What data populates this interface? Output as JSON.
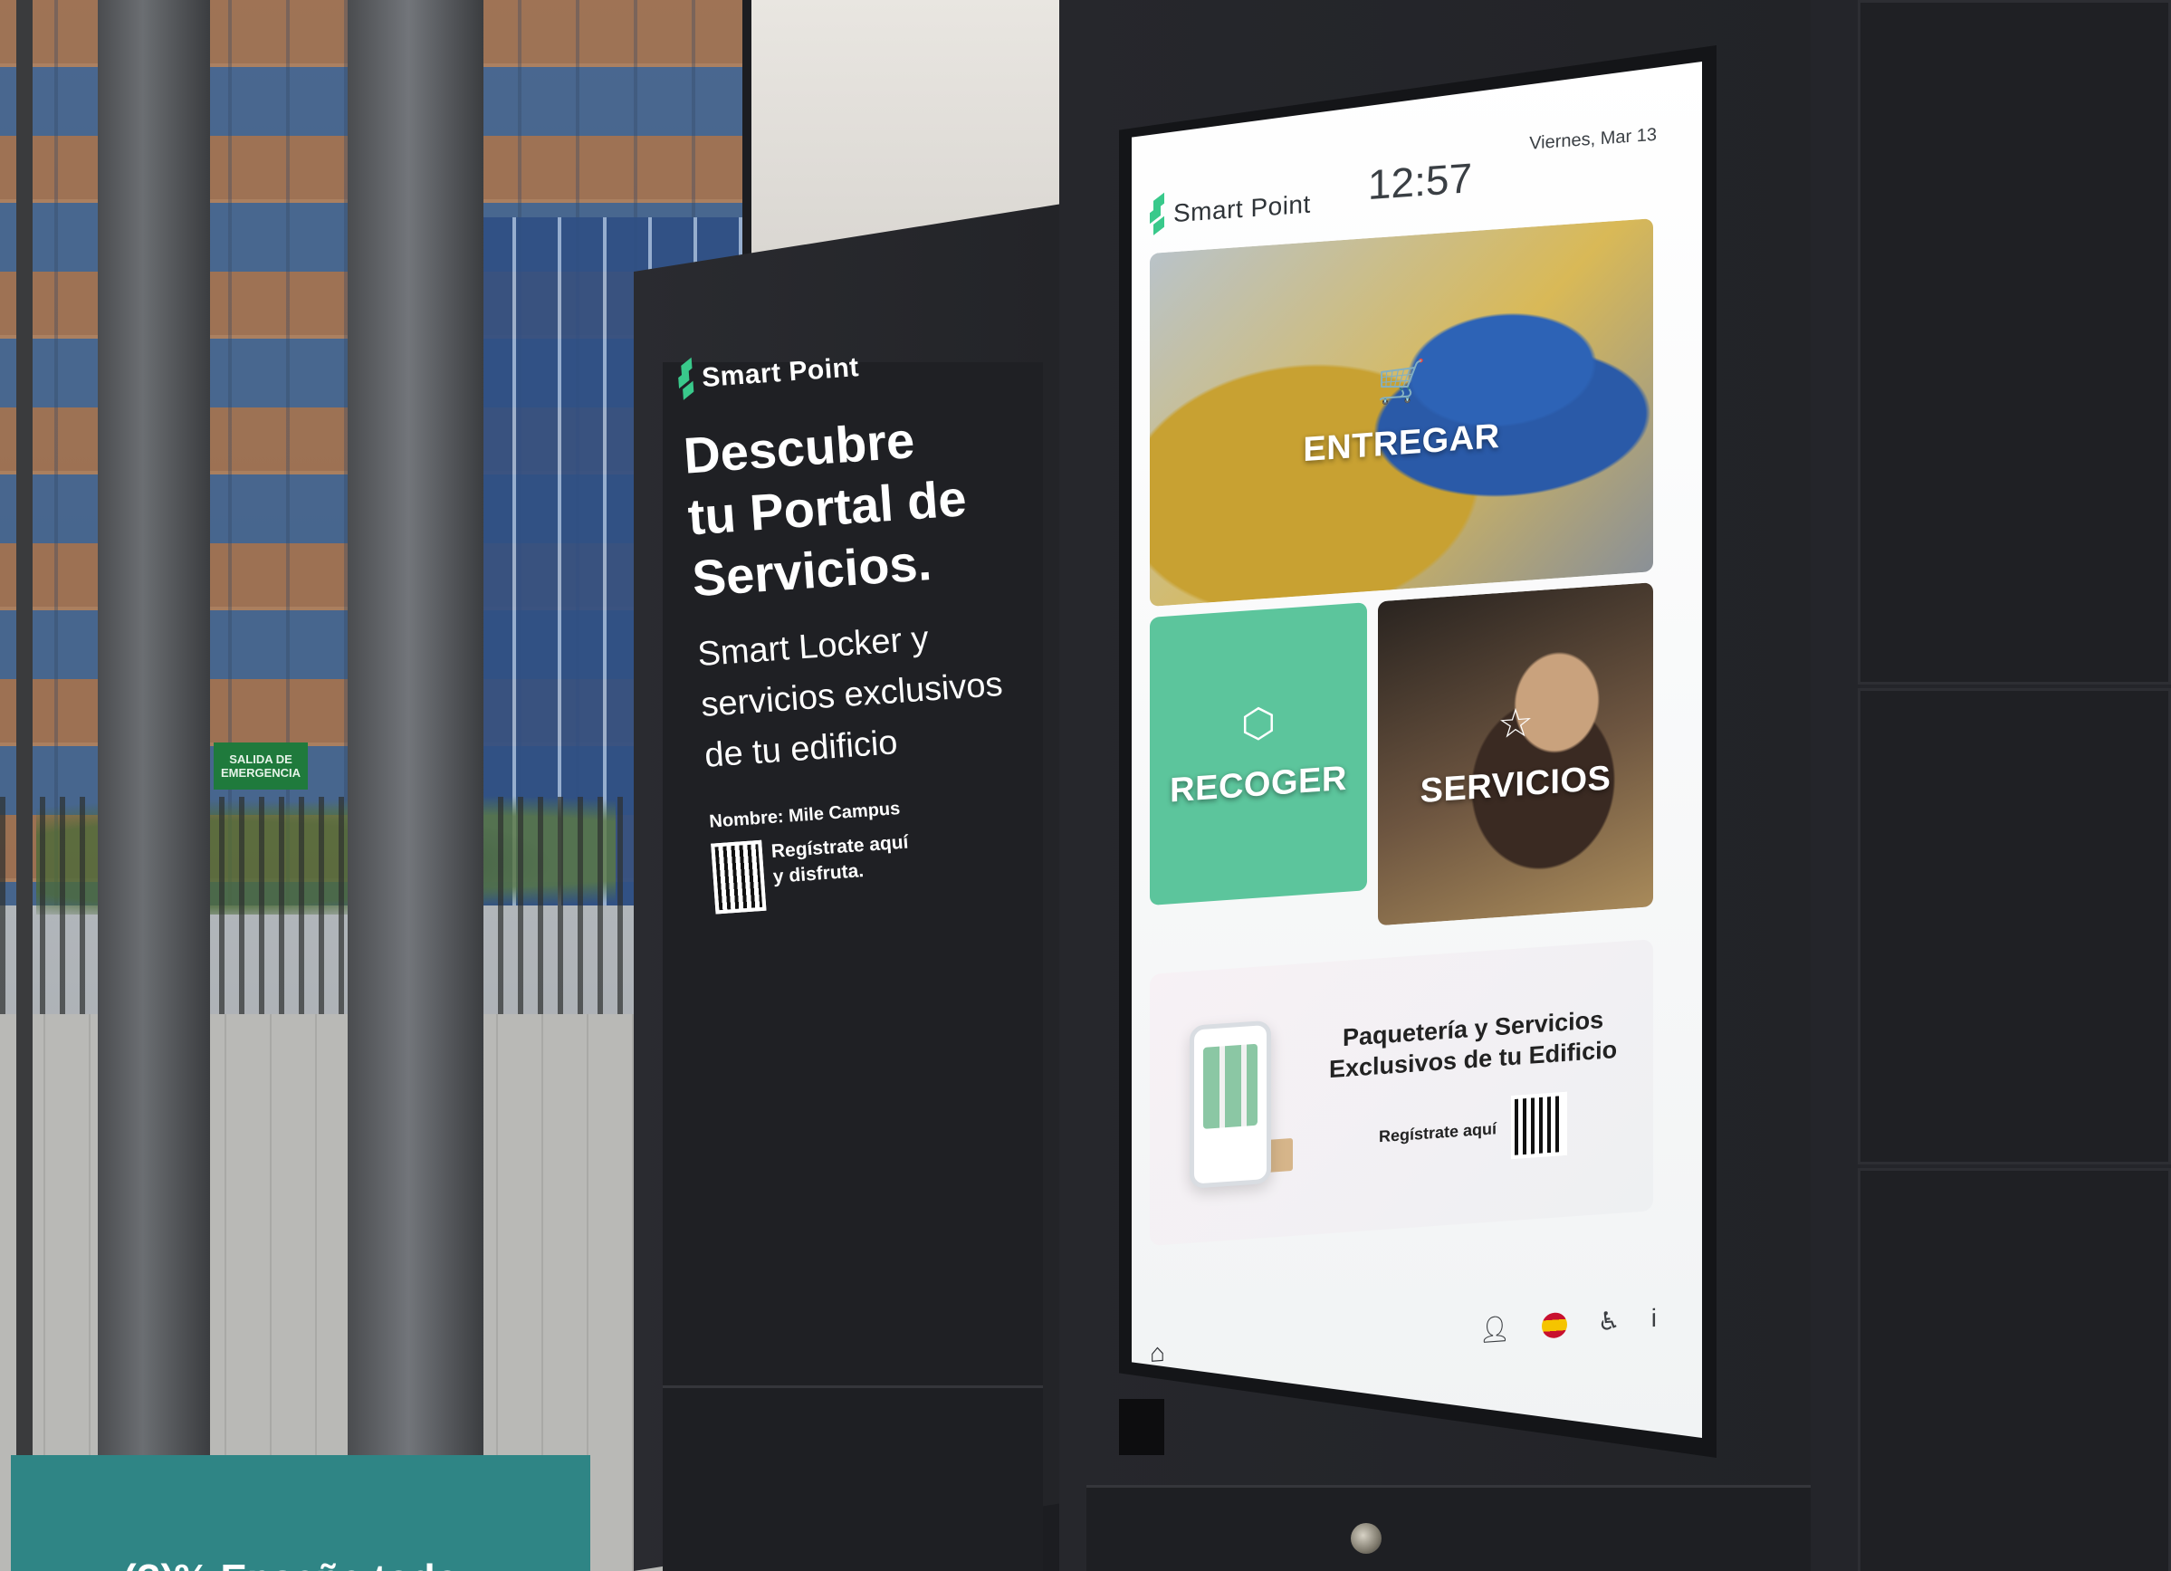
{
  "left_ad": {
    "brand_name": "Smart Point",
    "headline_lines": [
      "Descubre",
      "tu Portal de",
      "Servicios."
    ],
    "subtext_lines": [
      "Smart Locker y",
      "servicios exclusivos",
      "de tu edificio"
    ],
    "site_name": "Nombre: Mile Campus",
    "register_lines": [
      "Regístrate aquí",
      "y disfruta."
    ]
  },
  "window_sign": [
    "SALIDA DE",
    "EMERGENCIA"
  ],
  "kiosk": {
    "brand_name": "Smart Point",
    "time": "12:57",
    "date": "Viernes, Mar 13",
    "tiles": {
      "entregar": "ENTREGAR",
      "recoger": "RECOGER",
      "servicios": "SERVICIOS"
    },
    "promo": {
      "title_lines": [
        "Paquetería y Servicios",
        "Exclusivos de tu Edificio"
      ],
      "register": "Regístrate aquí"
    },
    "icons": {
      "home": "home-icon",
      "staff": "person-icon",
      "language": "spain-flag-icon",
      "accessibility": "accessibility-icon",
      "info": "info-icon"
    },
    "accent_color": "#5cc59c"
  },
  "caption": {
    "text": "(?)%  Enseñe todo..."
  }
}
